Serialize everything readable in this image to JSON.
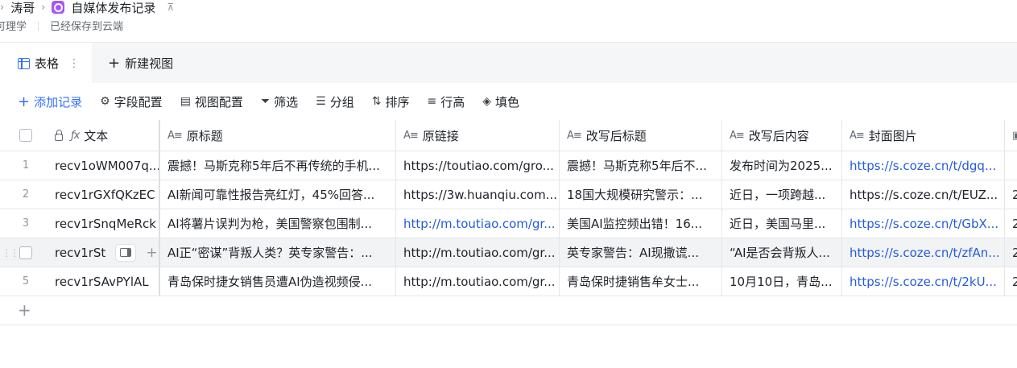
{
  "breadcrumb": {
    "parent": "涛哥",
    "current": "自媒体发布记录",
    "owner_fragment": "可理学",
    "save_status": "已经保存到云端"
  },
  "tabs": {
    "active": "表格",
    "new_view": "新建视图"
  },
  "toolbar": {
    "add_record": "添加记录",
    "field_config": "字段配置",
    "view_config": "视图配置",
    "filter": "筛选",
    "group": "分组",
    "sort": "排序",
    "row_height": "行高",
    "fill_color": "填色"
  },
  "columns": [
    "文本",
    "原标题",
    "原链接",
    "改写后标题",
    "改写后内容",
    "封面图片"
  ],
  "rows": [
    {
      "index": "1",
      "text": "recv1oWM007q...",
      "orig_title": "震撼！马斯克称5年后不再传统的手机...",
      "orig_link": "https://toutiao.com/gro...",
      "new_title": "震撼！马斯克称5年后不...",
      "new_content": "发布时间为2025...",
      "cover": "https://s.coze.cn/t/dgq...",
      "extra": ""
    },
    {
      "index": "2",
      "text": "recv1rGXfQKzEC",
      "orig_title": "AI新闻可靠性报告亮红灯，45%回答...",
      "orig_link": "https://3w.huanqiu.com...",
      "new_title": "18国大规模研究警示：...",
      "new_content": "近日，一项跨越...",
      "cover": "https://s.coze.cn/t/EUZ...",
      "extra": "2"
    },
    {
      "index": "3",
      "text": "recv1rSnqMeRck",
      "orig_title": "AI将薯片误判为枪，美国警察包围制...",
      "orig_link": "http://m.toutiao.com/gr...",
      "new_title": "美国AI监控频出错！16...",
      "new_content": "近日，美国马里...",
      "cover": "https://s.coze.cn/t/GbX...",
      "extra": "2"
    },
    {
      "index": "",
      "text": "recv1rSt",
      "orig_title": "AI正“密谋”背叛人类？英专家警告：...",
      "orig_link": "http://m.toutiao.com/gr...",
      "new_title": "英专家警告：AI现撒谎...",
      "new_content": "“AI是否会背叛人...",
      "cover": "https://s.coze.cn/t/zfAn...",
      "extra": "2"
    },
    {
      "index": "5",
      "text": "recv1rSAvPYlAL",
      "orig_title": "青岛保时捷女销售员遭AI伪造视频侵...",
      "orig_link": "http://m.toutiao.com/gr...",
      "new_title": "青岛保时捷销售牟女士...",
      "new_content": "10月10日，青岛...",
      "cover": "https://s.coze.cn/t/2kU...",
      "extra": "2"
    }
  ],
  "colors": {
    "accent": "#3370ff",
    "link": "#245bdb",
    "hover_row": "#f2f3f5"
  }
}
